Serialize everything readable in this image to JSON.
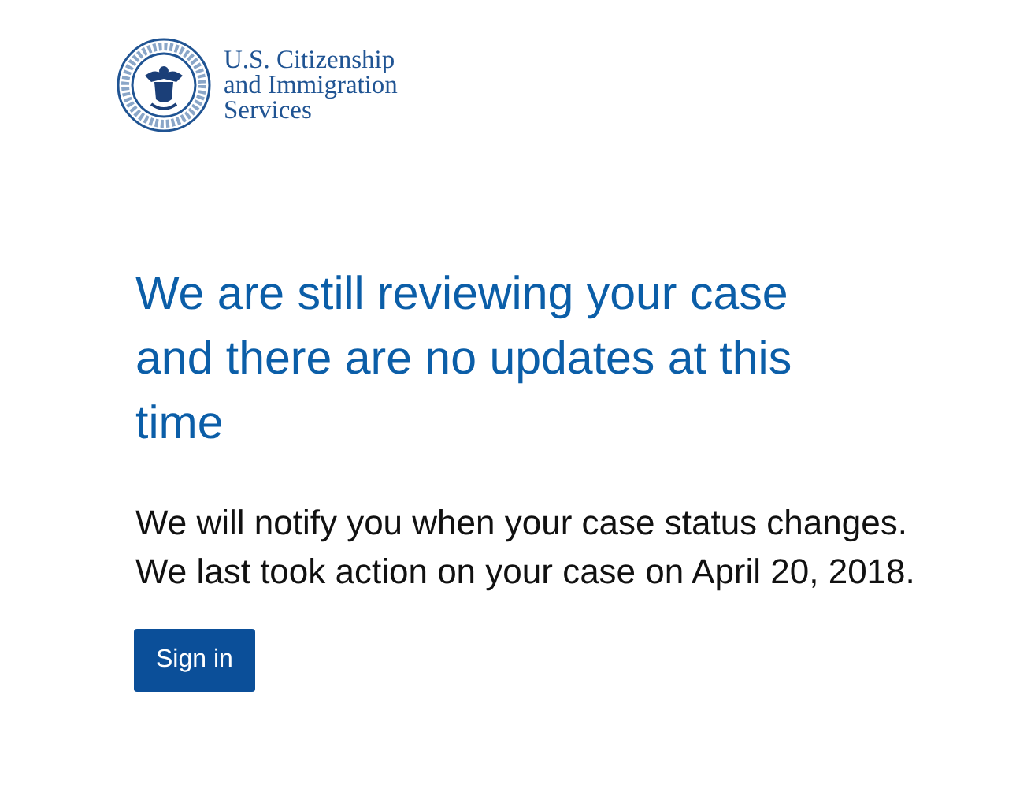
{
  "header": {
    "agency_lines": [
      "U.S. Citizenship",
      "and Immigration",
      "Services"
    ]
  },
  "status": {
    "title": "We are still reviewing your case and there are no updates at this time",
    "message": "We will notify you when your case status changes. We last took action on your case on April 20, 2018."
  },
  "buttons": [
    {
      "label": "Sign in"
    }
  ]
}
